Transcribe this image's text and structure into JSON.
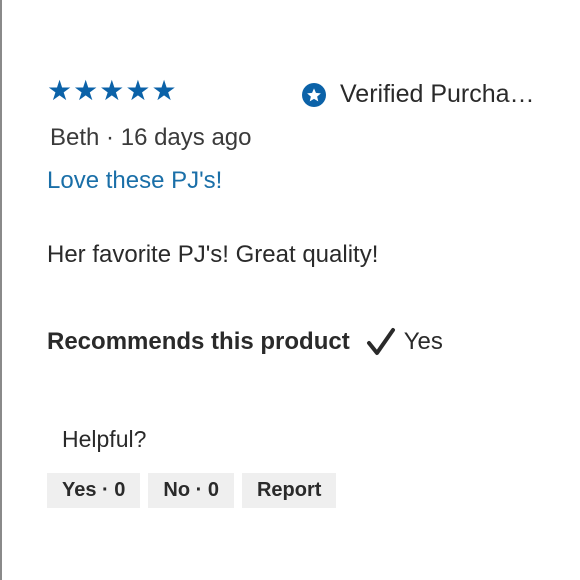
{
  "review": {
    "rating": 5,
    "rating_max": 5,
    "star_color": "#0b62a8",
    "verified_label": "Verified Purcha…",
    "verified_icon": "star-badge-icon",
    "author": "Beth",
    "separator": "·",
    "posted_ago": "16 days ago",
    "title": "Love these PJ's!",
    "body": "Her favorite PJ's! Great quality!",
    "recommends_label": "Recommends this product",
    "recommends_icon": "checkmark-icon",
    "recommends_value": "Yes"
  },
  "feedback": {
    "prompt": "Helpful?",
    "yes_label": "Yes · 0",
    "no_label": "No · 0",
    "report_label": "Report"
  }
}
